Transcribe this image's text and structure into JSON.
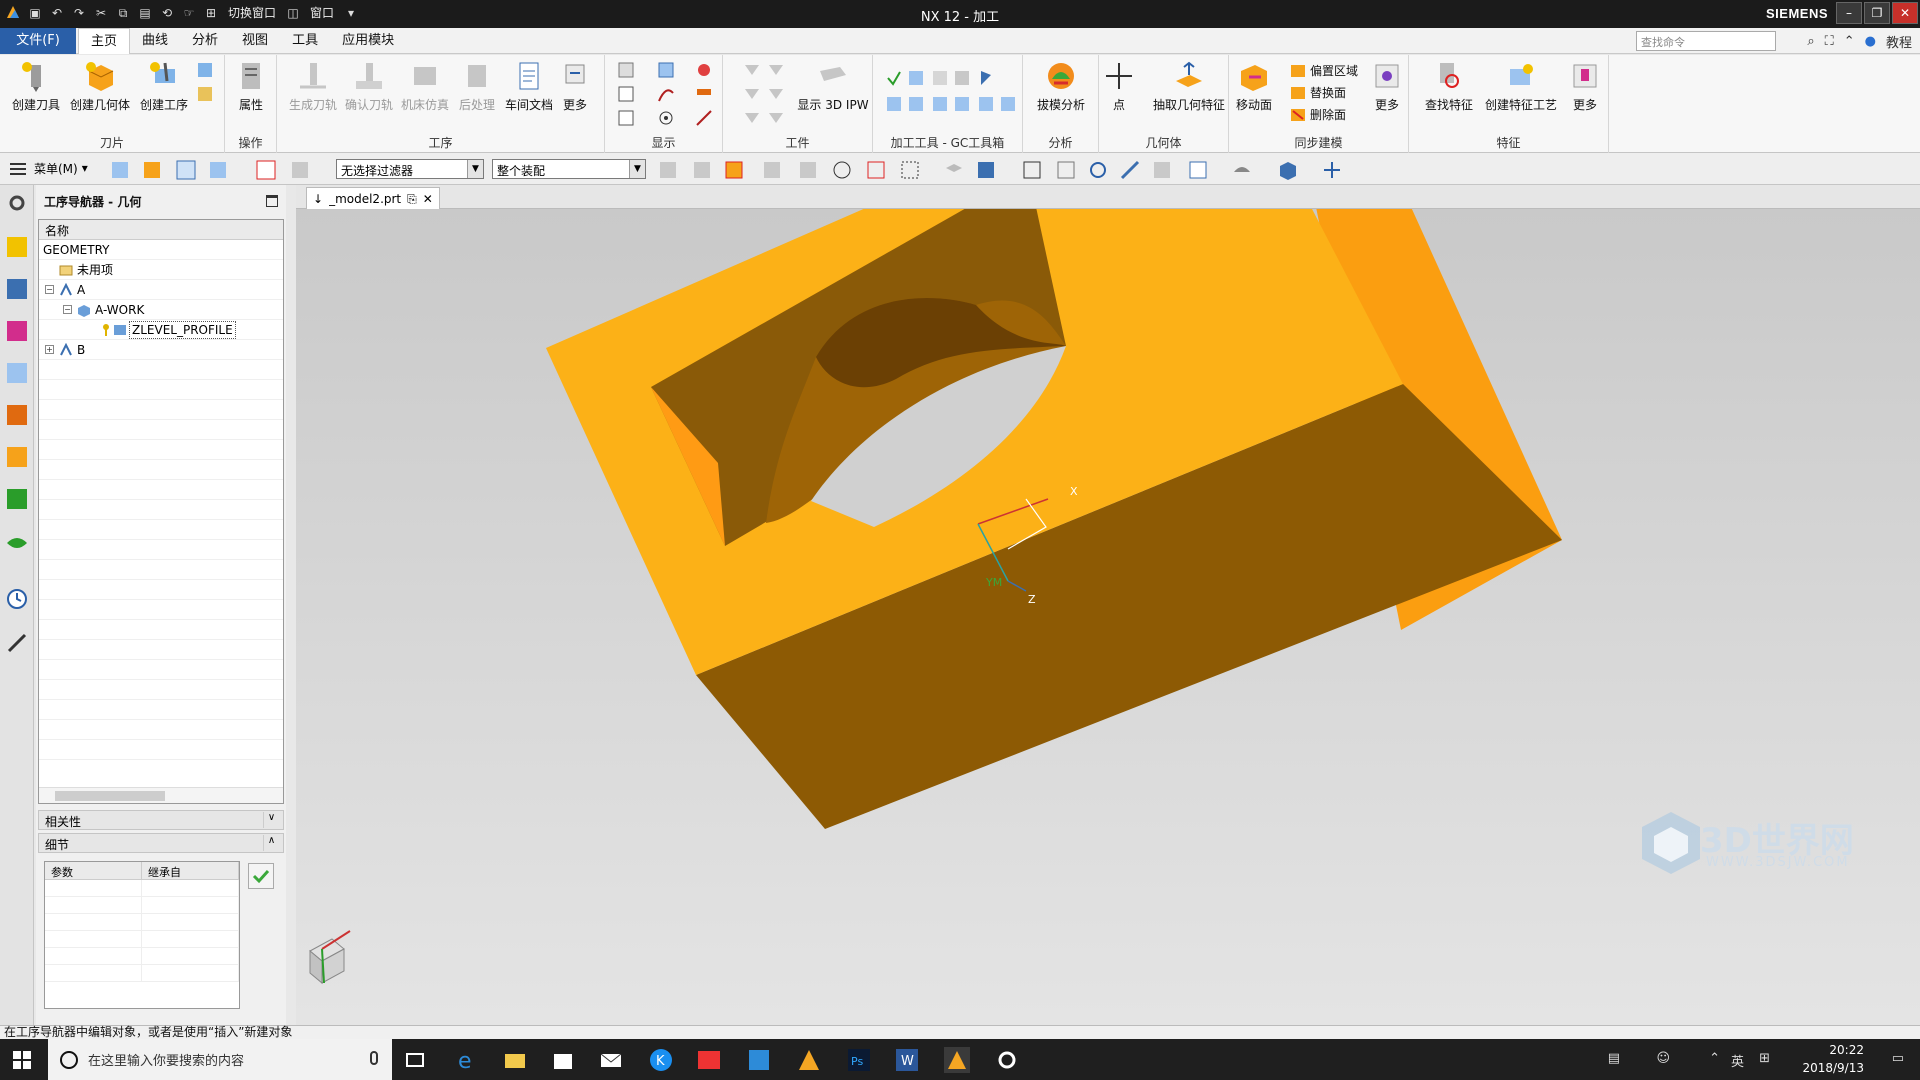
{
  "window": {
    "title": "NX 12 - 加工",
    "brand": "SIEMENS",
    "quick_access": [
      "切换窗口",
      "窗口"
    ]
  },
  "menu_tabs": {
    "file": "文件(F)",
    "tabs": [
      "主页",
      "曲线",
      "分析",
      "视图",
      "工具",
      "应用模块"
    ],
    "search_placeholder": "查找命令",
    "help": "教程"
  },
  "ribbon": {
    "groups": {
      "tool": {
        "label": "刀片",
        "buttons": [
          "创建刀具",
          "创建几何体",
          "创建工序"
        ]
      },
      "ops": {
        "label": "操作",
        "buttons": [
          "属性"
        ]
      },
      "process": {
        "label": "工序",
        "buttons": [
          "生成刀轨",
          "确认刀轨",
          "机床仿真",
          "后处理",
          "车间文档",
          "更多"
        ]
      },
      "display": {
        "label": "显示"
      },
      "workpiece": {
        "label": "工件",
        "buttons": [
          "显示 3D IPW"
        ]
      },
      "gc": {
        "label": "加工工具 - GC工具箱"
      },
      "analysis": {
        "label": "分析",
        "buttons": [
          "拔模分析"
        ]
      },
      "geometry": {
        "label": "几何体",
        "buttons": [
          "点",
          "抽取几何特征"
        ]
      },
      "sync": {
        "label": "同步建模",
        "buttons": [
          "移动面",
          "更多"
        ],
        "small": [
          "偏置区域",
          "替换面",
          "删除面"
        ]
      },
      "feature": {
        "label": "特征",
        "buttons": [
          "查找特征",
          "创建特征工艺",
          "更多"
        ]
      }
    }
  },
  "toolbar2": {
    "menu_label": "菜单(M)",
    "filter_value": "无选择过滤器",
    "assembly_value": "整个装配"
  },
  "navigator": {
    "title": "工序导航器 - 几何",
    "column": "名称",
    "rows": [
      {
        "label": "GEOMETRY"
      },
      {
        "label": "未用项"
      },
      {
        "label": "A"
      },
      {
        "label": "A-WORK"
      },
      {
        "label": "ZLEVEL_PROFILE"
      },
      {
        "label": "B"
      }
    ],
    "sections": {
      "dependency": "相关性",
      "details": "细节"
    },
    "detail_columns": [
      "参数",
      "继承自"
    ]
  },
  "document": {
    "tab": "_model2.prt"
  },
  "axes": {
    "x": "X",
    "y": "YM",
    "z": "Z"
  },
  "status": {
    "message": "在工序导航器中编辑对象，或者是使用“插入”新建对象"
  },
  "taskbar": {
    "search_placeholder": "在这里输入你要搜索的内容",
    "time": "20:22",
    "date": "2018/9/13",
    "lang": "英"
  },
  "watermark": {
    "text": "3D世界网",
    "url": "WWW.3DSJW.COM"
  },
  "colors": {
    "model_top": "#fcb117",
    "model_side": "#8d5a04",
    "model_face_right": "#fb9e10",
    "file_tab": "#2a5fa8"
  }
}
